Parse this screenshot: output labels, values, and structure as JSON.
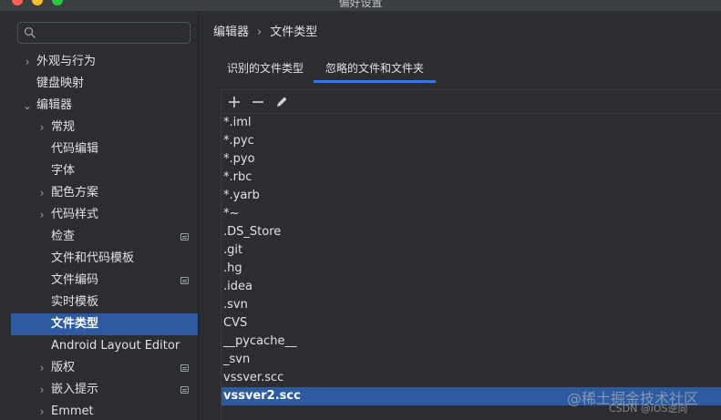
{
  "window": {
    "title": "偏好设置"
  },
  "search": {
    "placeholder": ""
  },
  "tree": [
    {
      "label": "外观与行为",
      "level": 0,
      "chevron": "›",
      "badge": false,
      "selected": false
    },
    {
      "label": "键盘映射",
      "level": 0,
      "chevron": "",
      "badge": false,
      "selected": false
    },
    {
      "label": "编辑器",
      "level": 0,
      "chevron": "⌄",
      "badge": false,
      "selected": false
    },
    {
      "label": "常规",
      "level": 1,
      "chevron": "›",
      "badge": false,
      "selected": false
    },
    {
      "label": "代码编辑",
      "level": 1,
      "chevron": "",
      "badge": false,
      "selected": false
    },
    {
      "label": "字体",
      "level": 1,
      "chevron": "",
      "badge": false,
      "selected": false
    },
    {
      "label": "配色方案",
      "level": 1,
      "chevron": "›",
      "badge": false,
      "selected": false
    },
    {
      "label": "代码样式",
      "level": 1,
      "chevron": "›",
      "badge": false,
      "selected": false
    },
    {
      "label": "检查",
      "level": 1,
      "chevron": "",
      "badge": true,
      "selected": false
    },
    {
      "label": "文件和代码模板",
      "level": 1,
      "chevron": "",
      "badge": false,
      "selected": false
    },
    {
      "label": "文件编码",
      "level": 1,
      "chevron": "",
      "badge": true,
      "selected": false
    },
    {
      "label": "实时模板",
      "level": 1,
      "chevron": "",
      "badge": false,
      "selected": false
    },
    {
      "label": "文件类型",
      "level": 1,
      "chevron": "",
      "badge": false,
      "selected": true
    },
    {
      "label": "Android Layout Editor",
      "level": 1,
      "chevron": "",
      "badge": false,
      "selected": false
    },
    {
      "label": "版权",
      "level": 1,
      "chevron": "›",
      "badge": true,
      "selected": false
    },
    {
      "label": "嵌入提示",
      "level": 1,
      "chevron": "›",
      "badge": true,
      "selected": false
    },
    {
      "label": "Emmet",
      "level": 1,
      "chevron": "›",
      "badge": false,
      "selected": false
    }
  ],
  "breadcrumb": {
    "parent": "编辑器",
    "separator": "›",
    "current": "文件类型"
  },
  "tabs": {
    "recognized": "识别的文件类型",
    "ignored": "忽略的文件和文件夹"
  },
  "toolbar": {
    "add_icon": "plus-icon",
    "remove_icon": "minus-icon",
    "edit_icon": "pencil-icon"
  },
  "ignored_items": [
    "*.iml",
    "*.pyc",
    "*.pyo",
    "*.rbc",
    "*.yarb",
    "*~",
    ".DS_Store",
    ".git",
    ".hg",
    ".idea",
    ".svn",
    "CVS",
    "__pycache__",
    "_svn",
    "vssver.scc",
    "vssver2.scc"
  ],
  "selected_item": "vssver2.scc",
  "watermark": {
    "line1": "@稀土掘金技术社区",
    "line2": "CSDN @iOS逆向"
  },
  "colors": {
    "selection": "#2e5b9f",
    "accent": "#3574f0",
    "background": "#2b2d30"
  }
}
